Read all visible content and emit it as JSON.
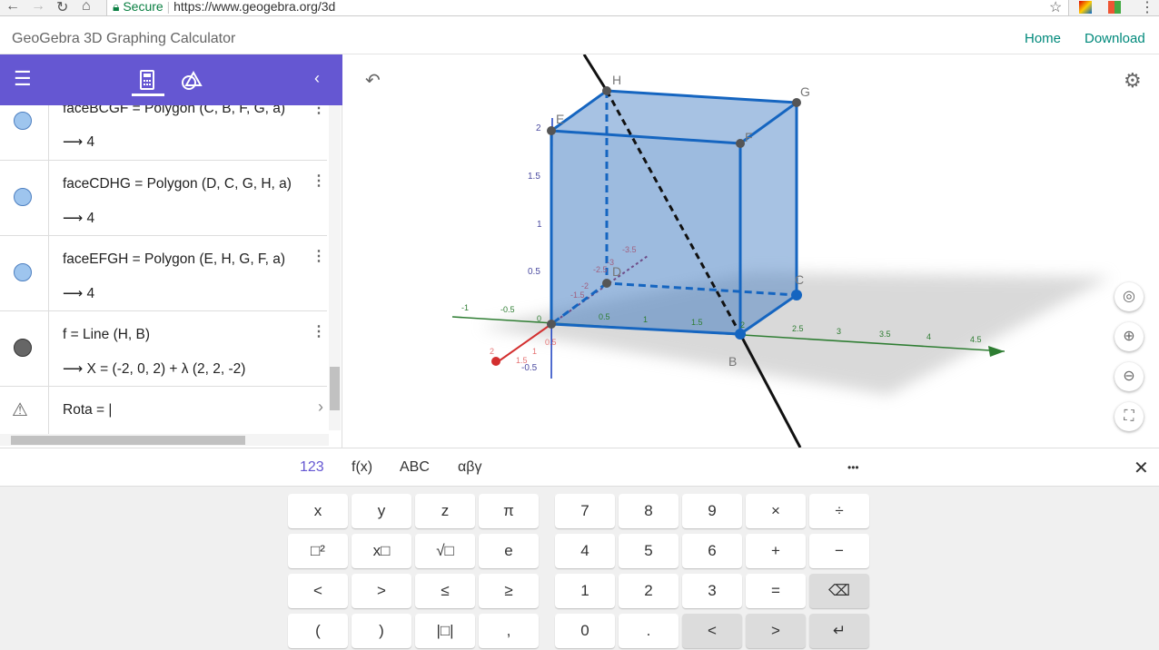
{
  "browser": {
    "secure_label": "Secure",
    "url": "https://www.geogebra.org/3d"
  },
  "header": {
    "title": "GeoGebra 3D Graphing Calculator",
    "home": "Home",
    "download": "Download"
  },
  "toolbar": {
    "icons": [
      "menu-icon",
      "calculator-icon",
      "tools-icon",
      "collapse-icon"
    ]
  },
  "algebra": {
    "items": [
      {
        "definition": "faceBCGF = Polygon (C, B, F, G, a)",
        "output": "⟶  4",
        "color": "#9ec5ee"
      },
      {
        "definition": "faceCDHG = Polygon (D, C, G, H, a)",
        "output": "⟶  4",
        "color": "#9ec5ee"
      },
      {
        "definition": "faceEFGH = Polygon (E, H, G, F, a)",
        "output": "⟶  4",
        "color": "#9ec5ee"
      },
      {
        "definition": "f = Line (H, B)",
        "output": "⟶  X = (-2, 0, 2) + λ (2, 2, -2)",
        "color": "#666666"
      }
    ],
    "input": {
      "value": "Rota = |",
      "status_icon": "warning-icon"
    }
  },
  "graphics": {
    "points": [
      "H",
      "G",
      "E",
      "F",
      "C",
      "B",
      "D"
    ],
    "z_ticks": [
      "2",
      "1.5",
      "1",
      "0.5",
      "-0.5"
    ],
    "y_ticks": [
      "-1",
      "-0.5",
      "0",
      "0.5",
      "1",
      "1.5",
      "2",
      "2.5",
      "3",
      "3.5",
      "4",
      "4.5"
    ],
    "x_ticks": [
      "0.5",
      "1",
      "1.5",
      "2",
      "-1.5",
      "-2",
      "-2.5",
      "-3",
      "-3.5"
    ]
  },
  "keyboard": {
    "tabs": [
      "123",
      "f(x)",
      "ABC",
      "αβγ"
    ],
    "more": "•••",
    "rows": [
      [
        "x",
        "y",
        "z",
        "π",
        "7",
        "8",
        "9",
        "×",
        "÷"
      ],
      [
        "□²",
        "x□",
        "√□",
        "e",
        "4",
        "5",
        "6",
        "+",
        "−"
      ],
      [
        "<",
        ">",
        "≤",
        "≥",
        "1",
        "2",
        "3",
        "=",
        "⌫"
      ],
      [
        "(",
        ")",
        "|□|",
        ",",
        "0",
        ".",
        "<",
        ">",
        "↵"
      ]
    ]
  },
  "colors": {
    "accent": "#6557d2",
    "cube": "#1565c0",
    "link": "#00897b"
  }
}
